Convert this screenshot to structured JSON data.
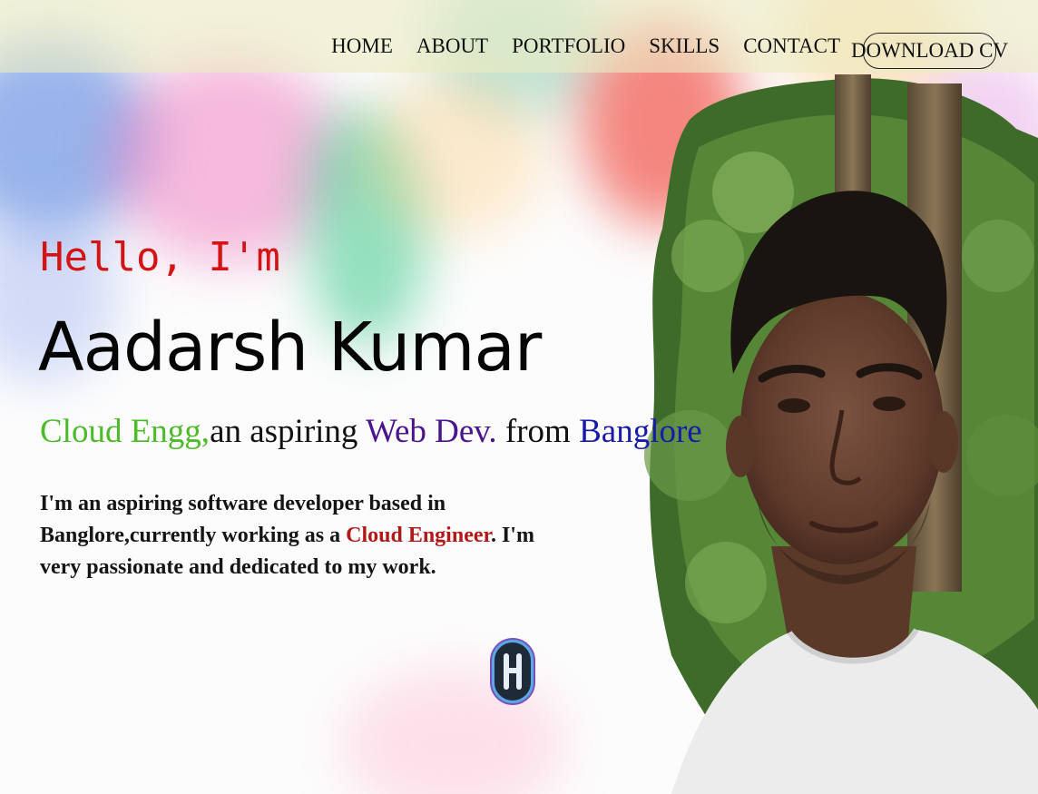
{
  "nav": {
    "links": [
      "HOME",
      "ABOUT",
      "PORTFOLIO",
      "SKILLS",
      "CONTACT"
    ],
    "cv_button": "DOWNLOAD CV"
  },
  "hero": {
    "greeting": "Hello, I'm",
    "name": "Aadarsh Kumar",
    "tagline": {
      "role": "Cloud Engg,",
      "mid": "an aspiring ",
      "webdev": "Web Dev.",
      "from": " from ",
      "city": "Banglore"
    },
    "about": {
      "before": "I'm an aspiring software developer based in Banglore,currently working as a ",
      "highlight": "Cloud Engineer",
      "after": ". I'm very passionate and dedicated to my work."
    }
  },
  "icons": {
    "scroll": "scroll-down-icon",
    "portrait": "profile-photo"
  },
  "colors": {
    "greeting": "#d41414",
    "role": "#4cba29",
    "webdev": "#4a148c",
    "city": "#1a1aa8",
    "highlight": "#b21818"
  }
}
